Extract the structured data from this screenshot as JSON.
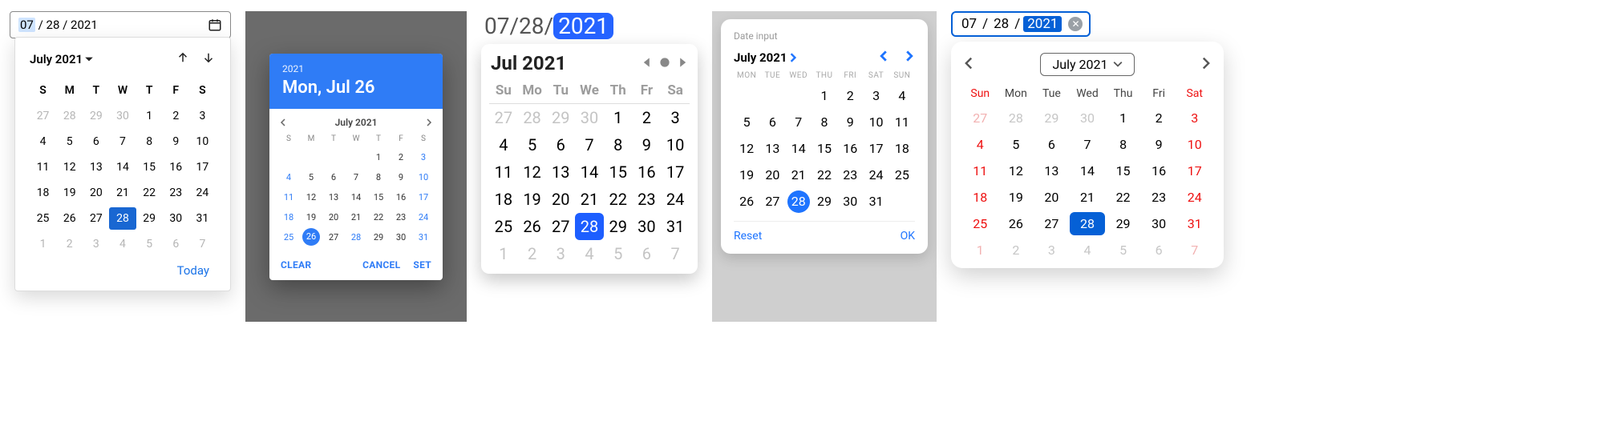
{
  "dow": {
    "one": [
      "S",
      "M",
      "T",
      "W",
      "T",
      "F",
      "S"
    ],
    "two": [
      "Su",
      "Mo",
      "Tu",
      "We",
      "Th",
      "Fr",
      "Sa"
    ],
    "three_upper": [
      "MON",
      "TUE",
      "WED",
      "THU",
      "FRI",
      "SAT",
      "SUN"
    ],
    "three_cap": [
      "Sun",
      "Mon",
      "Tue",
      "Wed",
      "Thu",
      "Fri",
      "Sat"
    ]
  },
  "p1": {
    "input": {
      "mm": "07",
      "sep1": " / ",
      "dd": "28",
      "sep2": " / ",
      "yyyy": "2021"
    },
    "title": "July 2021",
    "today_label": "Today",
    "selected": 28,
    "grid": [
      {
        "n": 27,
        "o": true
      },
      {
        "n": 28,
        "o": true
      },
      {
        "n": 29,
        "o": true
      },
      {
        "n": 30,
        "o": true
      },
      {
        "n": 1
      },
      {
        "n": 2
      },
      {
        "n": 3
      },
      {
        "n": 4
      },
      {
        "n": 5
      },
      {
        "n": 6
      },
      {
        "n": 7
      },
      {
        "n": 8
      },
      {
        "n": 9
      },
      {
        "n": 10
      },
      {
        "n": 11
      },
      {
        "n": 12
      },
      {
        "n": 13
      },
      {
        "n": 14
      },
      {
        "n": 15
      },
      {
        "n": 16
      },
      {
        "n": 17
      },
      {
        "n": 18
      },
      {
        "n": 19
      },
      {
        "n": 20
      },
      {
        "n": 21
      },
      {
        "n": 22
      },
      {
        "n": 23
      },
      {
        "n": 24
      },
      {
        "n": 25
      },
      {
        "n": 26
      },
      {
        "n": 27
      },
      {
        "n": 28,
        "s": true
      },
      {
        "n": 29
      },
      {
        "n": 30
      },
      {
        "n": 31
      },
      {
        "n": 1,
        "o": true
      },
      {
        "n": 2,
        "o": true
      },
      {
        "n": 3,
        "o": true
      },
      {
        "n": 4,
        "o": true
      },
      {
        "n": 5,
        "o": true
      },
      {
        "n": 6,
        "o": true
      },
      {
        "n": 7,
        "o": true
      }
    ]
  },
  "p2": {
    "header": {
      "year": "2021",
      "date": "Mon, Jul 26"
    },
    "subtitle": "July 2021",
    "actions": {
      "clear": "CLEAR",
      "cancel": "CANCEL",
      "set": "SET"
    },
    "selected": 26,
    "grid": [
      {
        "n": ""
      },
      {
        "n": ""
      },
      {
        "n": ""
      },
      {
        "n": ""
      },
      {
        "n": 1
      },
      {
        "n": 2
      },
      {
        "n": 3,
        "b": true
      },
      {
        "n": 4,
        "b": true
      },
      {
        "n": 5
      },
      {
        "n": 6
      },
      {
        "n": 7
      },
      {
        "n": 8
      },
      {
        "n": 9
      },
      {
        "n": 10,
        "b": true
      },
      {
        "n": 11,
        "b": true
      },
      {
        "n": 12
      },
      {
        "n": 13
      },
      {
        "n": 14
      },
      {
        "n": 15
      },
      {
        "n": 16
      },
      {
        "n": 17,
        "b": true
      },
      {
        "n": 18,
        "b": true
      },
      {
        "n": 19
      },
      {
        "n": 20
      },
      {
        "n": 21
      },
      {
        "n": 22
      },
      {
        "n": 23
      },
      {
        "n": 24,
        "b": true
      },
      {
        "n": 25,
        "b": true
      },
      {
        "n": 26,
        "s": true
      },
      {
        "n": 27
      },
      {
        "n": 28,
        "b": true
      },
      {
        "n": 29
      },
      {
        "n": 30
      },
      {
        "n": 31,
        "b": true
      }
    ]
  },
  "p3": {
    "input": {
      "mm": "07",
      "sep": "/",
      "dd": "28",
      "yyyy": "2021"
    },
    "title": "Jul 2021",
    "selected": 28,
    "grid": [
      {
        "n": 27,
        "o": true
      },
      {
        "n": 28,
        "o": true
      },
      {
        "n": 29,
        "o": true
      },
      {
        "n": 30,
        "o": true
      },
      {
        "n": 1
      },
      {
        "n": 2
      },
      {
        "n": 3
      },
      {
        "n": 4
      },
      {
        "n": 5
      },
      {
        "n": 6
      },
      {
        "n": 7
      },
      {
        "n": 8
      },
      {
        "n": 9
      },
      {
        "n": 10
      },
      {
        "n": 11
      },
      {
        "n": 12
      },
      {
        "n": 13
      },
      {
        "n": 14
      },
      {
        "n": 15
      },
      {
        "n": 16
      },
      {
        "n": 17
      },
      {
        "n": 18
      },
      {
        "n": 19
      },
      {
        "n": 20
      },
      {
        "n": 21
      },
      {
        "n": 22
      },
      {
        "n": 23
      },
      {
        "n": 24
      },
      {
        "n": 25
      },
      {
        "n": 26
      },
      {
        "n": 27
      },
      {
        "n": 28,
        "s": true
      },
      {
        "n": 29
      },
      {
        "n": 30
      },
      {
        "n": 31
      },
      {
        "n": 1,
        "o": true
      },
      {
        "n": 2,
        "o": true
      },
      {
        "n": 3,
        "o": true
      },
      {
        "n": 4,
        "o": true
      },
      {
        "n": 5,
        "o": true
      },
      {
        "n": 6,
        "o": true
      },
      {
        "n": 7,
        "o": true
      }
    ]
  },
  "p4": {
    "label": "Date input",
    "title": "July 2021",
    "actions": {
      "reset": "Reset",
      "ok": "OK"
    },
    "selected": 28,
    "grid": [
      {
        "n": ""
      },
      {
        "n": ""
      },
      {
        "n": ""
      },
      {
        "n": 1
      },
      {
        "n": 2
      },
      {
        "n": 3
      },
      {
        "n": 4
      },
      {
        "n": 5
      },
      {
        "n": 6
      },
      {
        "n": 7
      },
      {
        "n": 8
      },
      {
        "n": 9
      },
      {
        "n": 10
      },
      {
        "n": 11
      },
      {
        "n": 12
      },
      {
        "n": 13
      },
      {
        "n": 14
      },
      {
        "n": 15
      },
      {
        "n": 16
      },
      {
        "n": 17
      },
      {
        "n": 18
      },
      {
        "n": 19
      },
      {
        "n": 20
      },
      {
        "n": 21
      },
      {
        "n": 22
      },
      {
        "n": 23
      },
      {
        "n": 24
      },
      {
        "n": 25
      },
      {
        "n": 26
      },
      {
        "n": 27
      },
      {
        "n": 28,
        "s": true
      },
      {
        "n": 29
      },
      {
        "n": 30
      },
      {
        "n": 31
      },
      {
        "n": ""
      }
    ]
  },
  "p5": {
    "input": {
      "mm": "07",
      "sep": " / ",
      "dd": "28",
      "yyyy": "2021"
    },
    "title": "July 2021",
    "selected": 28,
    "grid": [
      {
        "n": 27,
        "o": true,
        "w": true
      },
      {
        "n": 28,
        "o": true
      },
      {
        "n": 29,
        "o": true
      },
      {
        "n": 30,
        "o": true
      },
      {
        "n": 1
      },
      {
        "n": 2
      },
      {
        "n": 3,
        "w": true
      },
      {
        "n": 4,
        "w": true
      },
      {
        "n": 5
      },
      {
        "n": 6
      },
      {
        "n": 7
      },
      {
        "n": 8
      },
      {
        "n": 9
      },
      {
        "n": 10,
        "w": true
      },
      {
        "n": 11,
        "w": true
      },
      {
        "n": 12
      },
      {
        "n": 13
      },
      {
        "n": 14
      },
      {
        "n": 15
      },
      {
        "n": 16
      },
      {
        "n": 17,
        "w": true
      },
      {
        "n": 18,
        "w": true
      },
      {
        "n": 19
      },
      {
        "n": 20
      },
      {
        "n": 21
      },
      {
        "n": 22
      },
      {
        "n": 23
      },
      {
        "n": 24,
        "w": true
      },
      {
        "n": 25,
        "w": true
      },
      {
        "n": 26
      },
      {
        "n": 27
      },
      {
        "n": 28,
        "s": true
      },
      {
        "n": 29
      },
      {
        "n": 30
      },
      {
        "n": 31,
        "w": true
      },
      {
        "n": 1,
        "o": true,
        "w": true
      },
      {
        "n": 2,
        "o": true
      },
      {
        "n": 3,
        "o": true
      },
      {
        "n": 4,
        "o": true
      },
      {
        "n": 5,
        "o": true
      },
      {
        "n": 6,
        "o": true
      },
      {
        "n": 7,
        "o": true,
        "w": true
      }
    ]
  }
}
